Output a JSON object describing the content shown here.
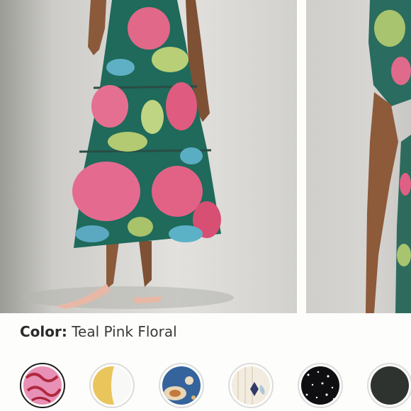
{
  "product": {
    "color_label": "Color:",
    "color_value": "Teal Pink Floral"
  },
  "images": [
    {
      "icon": "model-full-dress-photo"
    },
    {
      "icon": "model-detail-photo"
    }
  ],
  "swatches": [
    {
      "name": "Pink Red Squiggle",
      "colors": [
        "#e78fb6",
        "#b02a3e"
      ],
      "selected": true
    },
    {
      "name": "Yellow White Split",
      "colors": [
        "#e8c45a",
        "#f8f8f6"
      ],
      "selected": false
    },
    {
      "name": "Blue Paisley",
      "colors": [
        "#35639c",
        "#e8d6b6"
      ],
      "selected": false
    },
    {
      "name": "Cream Stripe",
      "colors": [
        "#f2ece0",
        "#2f3b66"
      ],
      "selected": false
    },
    {
      "name": "Black Dot",
      "colors": [
        "#0f0f12",
        "#ffffff"
      ],
      "selected": false
    },
    {
      "name": "Charcoal",
      "colors": [
        "#2f3330"
      ],
      "selected": false
    }
  ]
}
